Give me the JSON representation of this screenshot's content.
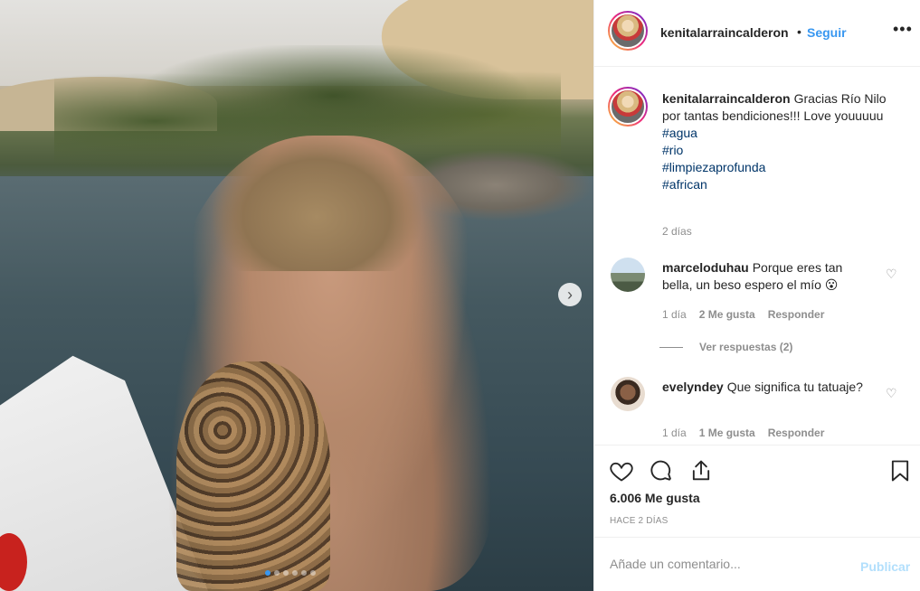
{
  "post": {
    "slides_total": 6,
    "slide_active": 1,
    "next_icon": "chevron-right-icon"
  },
  "header": {
    "username": "kenitalarraincalderon",
    "separator": "•",
    "follow_label": "Seguir",
    "more_icon": "ellipsis-icon"
  },
  "caption": {
    "username": "kenitalarraincalderon",
    "text": "Gracias Río Nilo por tantas bendiciones!!! Love youuuuu",
    "hashtags": [
      "#agua",
      "#rio",
      "#limpiezaprofunda",
      "#african"
    ],
    "time": "2 días"
  },
  "comments": [
    {
      "username": "marceloduhau",
      "text": "Porque eres tan bella, un beso espero el mío 😮",
      "time": "1 día",
      "likes": "2 Me gusta",
      "reply_label": "Responder",
      "view_replies": "Ver respuestas (2)"
    },
    {
      "username": "evelyndey",
      "text": "Que significa tu tatuaje?",
      "time": "1 día",
      "likes": "1 Me gusta",
      "reply_label": "Responder"
    }
  ],
  "actions": {
    "icons": [
      "heart-icon",
      "comment-icon",
      "share-icon",
      "bookmark-icon"
    ],
    "likes_count": "6.006 Me gusta",
    "date": "HACE 2 DÍAS"
  },
  "add_comment": {
    "placeholder": "Añade un comentario...",
    "publish_label": "Publicar"
  },
  "colors": {
    "accent": "#3897f0",
    "publish_disabled": "#b2dffc",
    "hashtag": "#003569",
    "muted": "#8e8e8e",
    "text": "#262626"
  }
}
